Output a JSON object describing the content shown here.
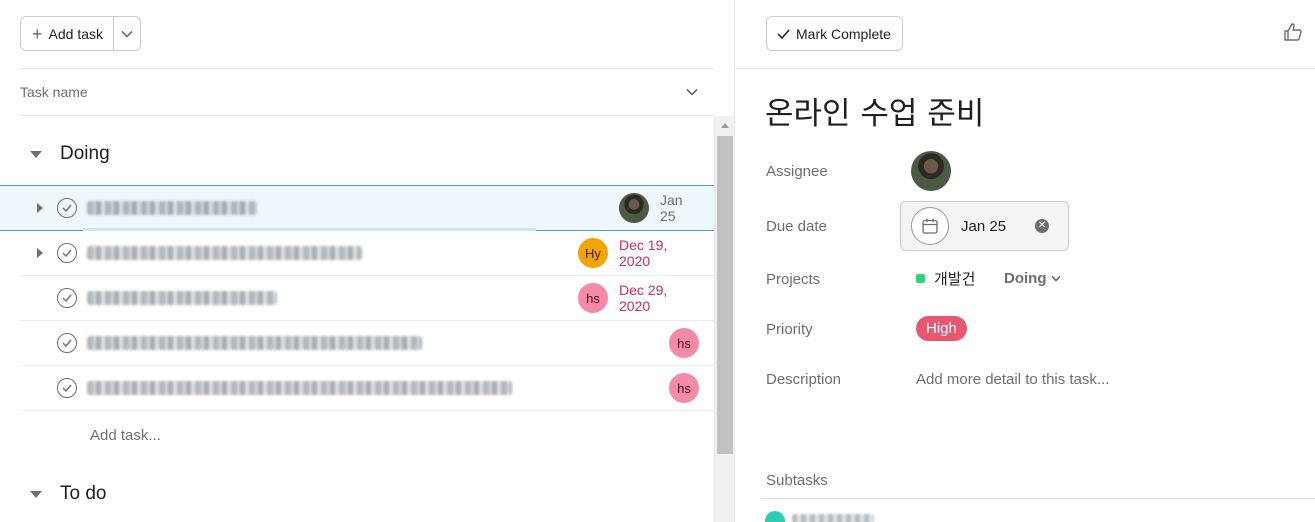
{
  "toolbar": {
    "add_task_label": "Add task"
  },
  "list_header": {
    "column_label": "Task name"
  },
  "sections": [
    {
      "name": "Doing"
    },
    {
      "name": "To do"
    }
  ],
  "tasks": [
    {
      "assignee": "",
      "due": "Jan 25"
    },
    {
      "assignee": "Hy",
      "due": "Dec 19, 2020"
    },
    {
      "assignee": "hs",
      "due": "Dec 29, 2020"
    },
    {
      "assignee": "hs",
      "due": ""
    },
    {
      "assignee": "hs",
      "due": ""
    }
  ],
  "add_task_inline": "Add task...",
  "colors": {
    "accent_blue": "#4aa3cf",
    "overdue_red": "#c92f54",
    "priority_high": "#e8566f",
    "project_green": "#2bd67b",
    "hy_orange": "#f3a400",
    "hs_pink": "#f48aa6"
  },
  "detail": {
    "mark_complete_label": "Mark Complete",
    "title": "온라인 수업 준비",
    "fields": {
      "assignee_label": "Assignee",
      "due_date_label": "Due date",
      "due_date_value": "Jan 25",
      "projects_label": "Projects",
      "project_name": "개발건",
      "project_section": "Doing",
      "priority_label": "Priority",
      "priority_value": "High",
      "description_label": "Description",
      "description_placeholder": "Add more detail to this task..."
    },
    "subtasks_label": "Subtasks"
  }
}
